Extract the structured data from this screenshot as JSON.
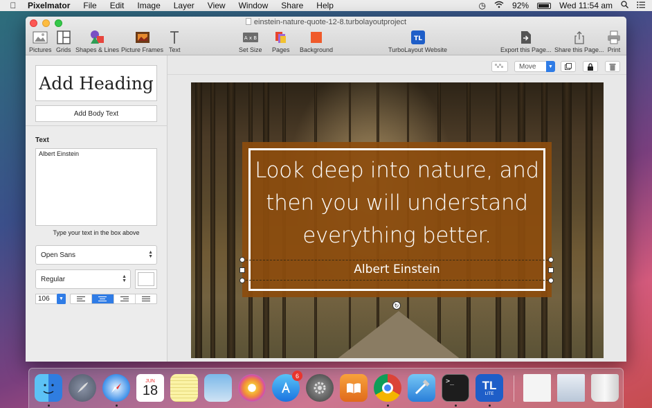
{
  "menubar": {
    "app_name": "Pixelmator",
    "items": [
      "File",
      "Edit",
      "Image",
      "Layer",
      "View",
      "Window",
      "Share",
      "Help"
    ],
    "battery": "92%",
    "clock": "Wed 11:54 am"
  },
  "window": {
    "title": "einstein-nature-quote-12-8.turbolayoutproject",
    "toolbar": {
      "pictures": "Pictures",
      "grids": "Grids",
      "shapes": "Shapes & Lines",
      "frames": "Picture Frames",
      "text": "Text",
      "set_size": "Set Size",
      "pages": "Pages",
      "background": "Background",
      "website": "TurboLayout Website",
      "export": "Export this Page...",
      "share": "Share this Page...",
      "print": "Print"
    }
  },
  "sidebar": {
    "add_heading": "Add Heading",
    "add_body_text": "Add Body Text",
    "section_title": "Text",
    "text_value": "Albert Einstein",
    "hint": "Type your text in the box above",
    "font_family": "Open Sans",
    "font_style": "Regular",
    "font_size": "106"
  },
  "canvas": {
    "mode": "Move",
    "quote": "Look deep into nature, and then you will understand everything better.",
    "author": "Albert Einstein"
  },
  "dock": {
    "calendar_month": "JUN",
    "calendar_day": "18",
    "appstore_badge": "6",
    "terminal_text": ">_",
    "turbolayout_text": "TL",
    "turbolayout_tag": "LITE"
  },
  "colors": {
    "accent": "#2f7ce6",
    "quote_box": "#8c4c0e"
  }
}
